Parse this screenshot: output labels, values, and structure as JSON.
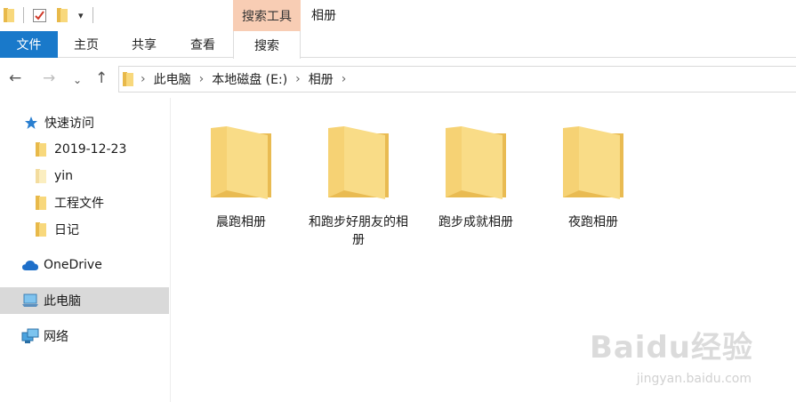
{
  "window": {
    "title": "相册"
  },
  "qat": {
    "dropdown_glyph": "▾"
  },
  "ribbon": {
    "contextual_header": "搜索工具",
    "tabs": [
      {
        "label": "文件"
      },
      {
        "label": "主页"
      },
      {
        "label": "共享"
      },
      {
        "label": "查看"
      },
      {
        "label": "搜索"
      }
    ]
  },
  "address": {
    "path": [
      "此电脑",
      "本地磁盘 (E:)",
      "相册"
    ],
    "separator": "›"
  },
  "nav": {
    "quick_access": "快速访问",
    "pinned": [
      "2019-12-23",
      "yin",
      "工程文件",
      "日记"
    ],
    "onedrive": "OneDrive",
    "this_pc": "此电脑",
    "network": "网络"
  },
  "folders": [
    {
      "name": "晨跑相册"
    },
    {
      "name": "和跑步好朋友的相册"
    },
    {
      "name": "跑步成就相册"
    },
    {
      "name": "夜跑相册"
    }
  ],
  "watermark": {
    "brand": "Baidu经验",
    "url": "jingyan.baidu.com"
  },
  "colors": {
    "accent": "#1979ca",
    "contextual": "#f8cdb4",
    "selected": "#d9d9d9",
    "folder": "#f8d87c"
  }
}
